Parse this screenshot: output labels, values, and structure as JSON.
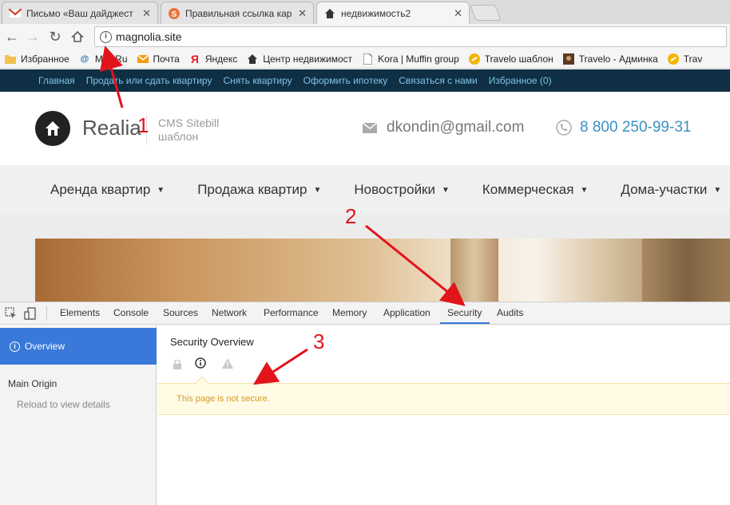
{
  "browser": {
    "tabs": [
      {
        "title": "Письмо «Ваш дайджест",
        "icon": "gmail-icon"
      },
      {
        "title": "Правильная ссылка кар",
        "icon": "s-icon"
      },
      {
        "title": "недвижимость2",
        "icon": "house-icon"
      }
    ],
    "url": "magnolia.site"
  },
  "bookmarks": [
    {
      "label": "Избранное",
      "icon": "folder-icon"
    },
    {
      "label": "Mail.Ru",
      "icon": "mailru-icon"
    },
    {
      "label": "Почта",
      "icon": "mail-icon"
    },
    {
      "label": "Яндекс",
      "icon": "yandex-icon"
    },
    {
      "label": "Центр недвижимост",
      "icon": "house-icon"
    },
    {
      "label": "Kora | Muffin group",
      "icon": "page-icon"
    },
    {
      "label": "Travelo шаблон",
      "icon": "travelo-icon"
    },
    {
      "label": "Travelo - Админка",
      "icon": "travelo-admin-icon"
    },
    {
      "label": "Trav",
      "icon": "travelo-icon"
    }
  ],
  "site": {
    "top_nav": [
      "Главная",
      "Продать или сдать квартиру",
      "Снять квартиру",
      "Оформить ипотеку",
      "Связаться с нами",
      "Избранное (0)"
    ],
    "logo_text": "Realia",
    "cms_line1": "CMS Sitebill",
    "cms_line2": "шаблон",
    "email": "dkondin@gmail.com",
    "phone": "8 800 250-99-31",
    "menu": [
      "Аренда квартир",
      "Продажа квартир",
      "Новостройки",
      "Коммерческая",
      "Дома-участки"
    ]
  },
  "devtools": {
    "tabs": [
      "Elements",
      "Console",
      "Sources",
      "Network",
      "Performance",
      "Memory",
      "Application",
      "Security",
      "Audits"
    ],
    "active_tab": "Security",
    "sidebar": {
      "overview": "Overview",
      "main_origin": "Main Origin",
      "reload": "Reload to view details"
    },
    "panel_title": "Security Overview",
    "message": "This page is not secure."
  },
  "annotations": [
    "1",
    "2",
    "3"
  ],
  "colors": {
    "annotation": "#e1141b",
    "devtools_accent": "#3879d9",
    "warning_text": "#d99a22",
    "site_nav_bg": "#0f2f44",
    "phone": "#3a91c4"
  }
}
